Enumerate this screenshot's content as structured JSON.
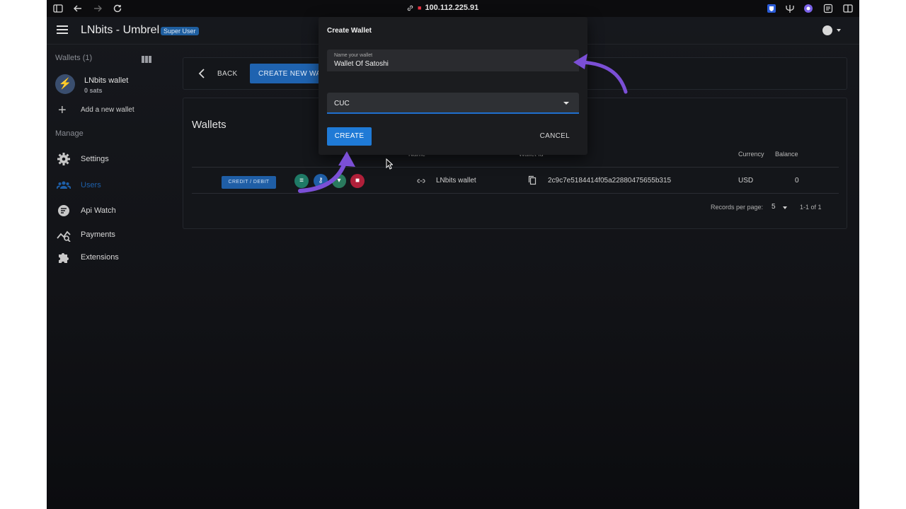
{
  "browser": {
    "address": "100.112.225.91"
  },
  "header": {
    "title": "LNbits - Umbrel",
    "badge": "Super User"
  },
  "sidebar": {
    "wallets_heading": "Wallets (1)",
    "wallet": {
      "name": "LNbits wallet",
      "balance": "0 sats"
    },
    "add_wallet_label": "Add a new wallet",
    "manage_heading": "Manage",
    "items": [
      {
        "label": "Settings",
        "icon": "gear-icon"
      },
      {
        "label": "Users",
        "icon": "users-icon"
      },
      {
        "label": "Api Watch",
        "icon": "api-watch-icon"
      },
      {
        "label": "Payments",
        "icon": "payments-chart-icon"
      },
      {
        "label": "Extensions",
        "icon": "puzzle-icon"
      }
    ]
  },
  "toolbar": {
    "back_label": "BACK",
    "create_new_label": "CREATE NEW WALLET"
  },
  "wallets": {
    "title": "Wallets",
    "columns": [
      "Name",
      "Wallet Id",
      "Currency",
      "Balance"
    ],
    "rows": [
      {
        "action": "CREDIT / DEBIT",
        "name": "LNbits wallet",
        "wallet_id": "2c9c7e5184414f05a22880475655b315",
        "currency": "USD",
        "balance": "0"
      }
    ],
    "pager": {
      "label": "Records per page:",
      "per_page": "5",
      "range": "1-1 of 1"
    }
  },
  "dialog": {
    "title": "Create Wallet",
    "name_label": "Name your wallet",
    "name_value": "Wallet Of Satoshi",
    "currency": "CUC",
    "create_label": "CREATE",
    "cancel_label": "CANCEL"
  },
  "colors": {
    "accent": "#1f7ad6",
    "annotation_arrow": "#7b4fd6",
    "delete": "#b0203a",
    "teal": "#1f7a66"
  }
}
